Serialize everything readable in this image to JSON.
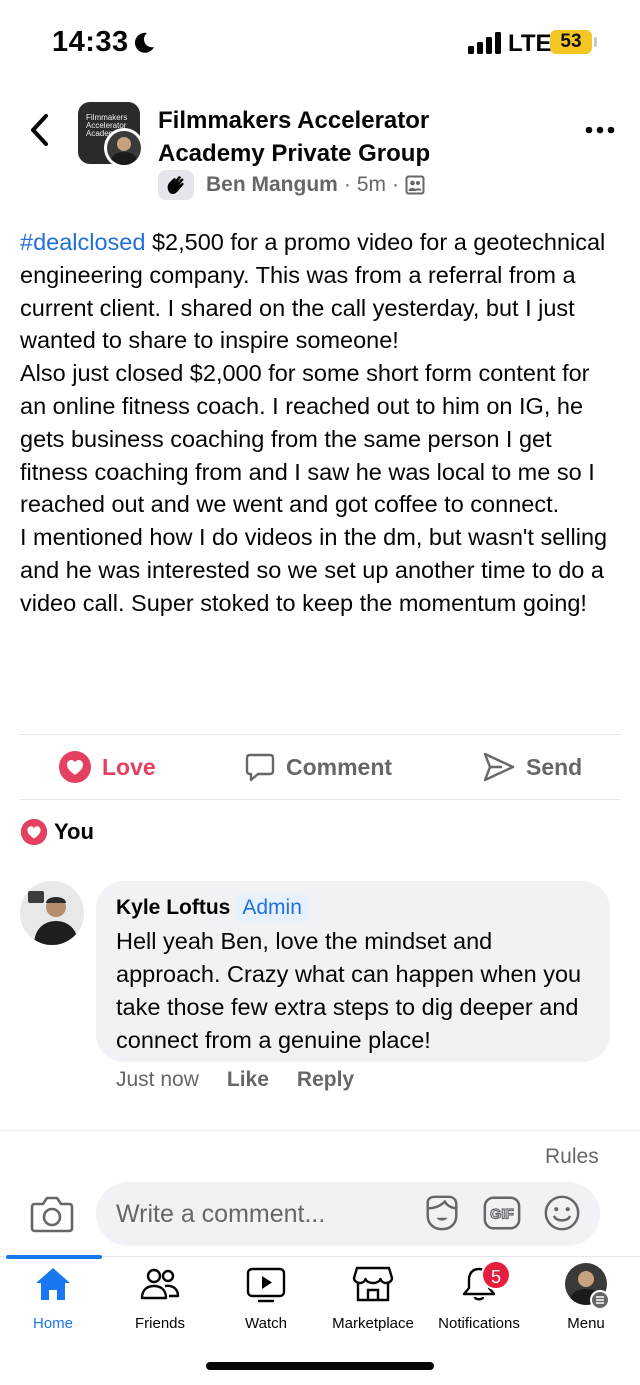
{
  "status_bar": {
    "time": "14:33",
    "network": "LTE",
    "battery": "53"
  },
  "header": {
    "group_name": "Filmmakers Accelerator Academy Private Group",
    "author": "Ben Mangum",
    "time_ago": "5m",
    "separator": "·",
    "avatar_text": "Filmmakers Accelerator Academy"
  },
  "post": {
    "hashtag": "#dealclosed",
    "text_1": " $2,500 for a promo video for a geotechnical engineering company. This was from a referral from a current client. I shared on the call yesterday, but I just wanted to share to inspire someone!",
    "text_2": "Also just closed $2,000 for some short form content for an online fitness coach. I reached out to him on IG, he gets business coaching from the same person I get fitness coaching from and I saw he was local to me so I reached out and we went and got coffee to connect.",
    "text_3": "I mentioned how I do videos in the dm, but wasn't selling and he was interested so we set up another time to do a video call. Super stoked to keep the momentum going!"
  },
  "actions": {
    "love": "Love",
    "comment": "Comment",
    "send": "Send"
  },
  "reactions": {
    "label": "You"
  },
  "comment": {
    "author": "Kyle Loftus",
    "badge": "Admin",
    "text": "Hell yeah Ben, love the mindset and approach. Crazy what can happen when you take those few extra steps to dig deeper and connect from a genuine place!",
    "time": "Just now",
    "like": "Like",
    "reply": "Reply"
  },
  "composer": {
    "rules": "Rules",
    "placeholder": "Write a comment..."
  },
  "tabs": [
    {
      "label": "Home"
    },
    {
      "label": "Friends"
    },
    {
      "label": "Watch"
    },
    {
      "label": "Marketplace"
    },
    {
      "label": "Notifications",
      "badge": "5"
    },
    {
      "label": "Menu"
    }
  ],
  "colors": {
    "accent": "#1877f2",
    "love": "#e4405f",
    "hashtag": "#216fdb",
    "badge_red": "#e41e3f",
    "battery": "#f3c623"
  }
}
